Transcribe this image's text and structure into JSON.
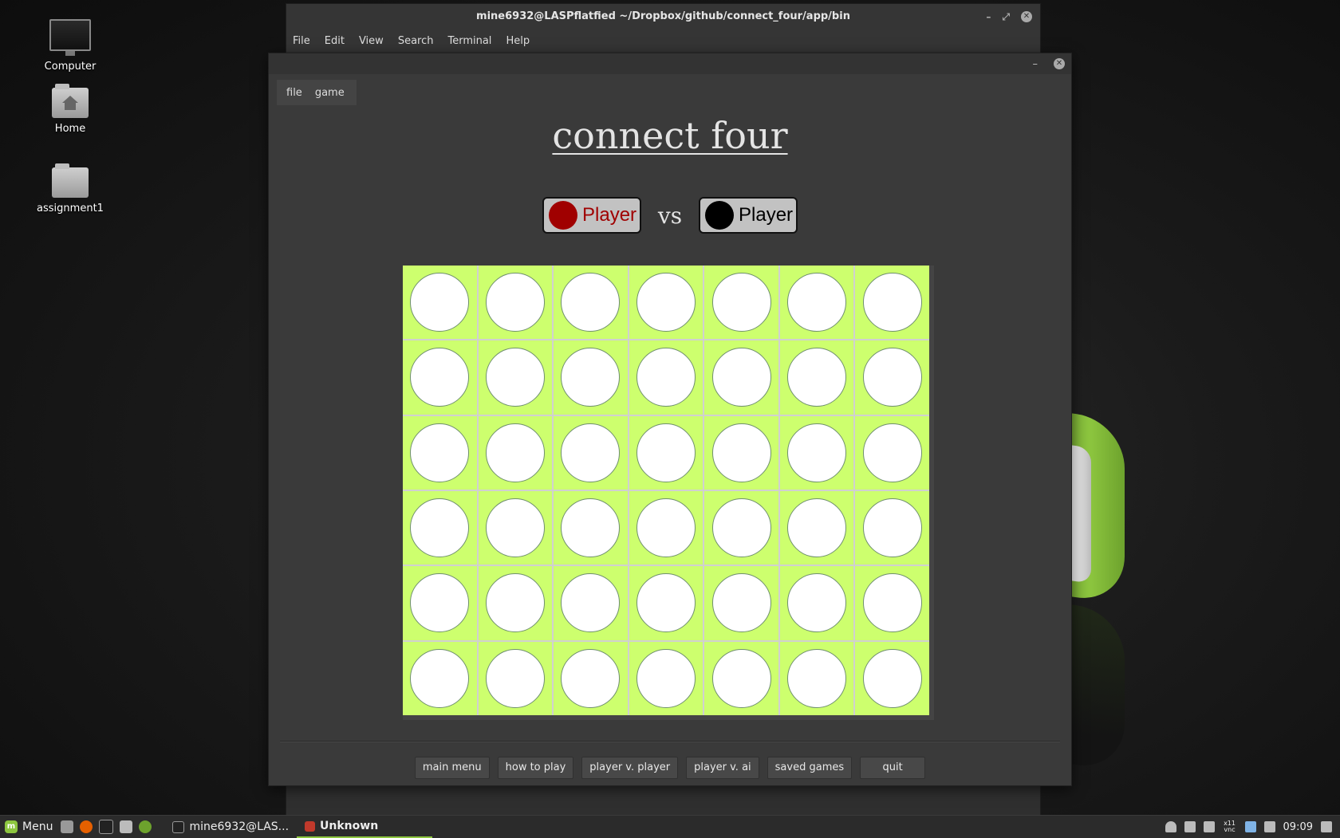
{
  "desktop": {
    "icons": [
      {
        "label": "Computer"
      },
      {
        "label": "Home"
      },
      {
        "label": "assignment1"
      }
    ]
  },
  "terminal": {
    "title": "mine6932@LASPflatfied ~/Dropbox/github/connect_four/app/bin",
    "menu": [
      "File",
      "Edit",
      "View",
      "Search",
      "Terminal",
      "Help"
    ]
  },
  "app": {
    "menu": [
      "file",
      "game"
    ],
    "title": "connect four",
    "player1": {
      "label": "Player",
      "color": "#a00000"
    },
    "vs": "vs",
    "player2": {
      "label": "Player",
      "color": "#000000"
    },
    "board": {
      "rows": 6,
      "cols": 7,
      "cell_color": "#cdff6e",
      "empty_color": "#ffffff"
    },
    "buttons": [
      "main menu",
      "how to play",
      "player v. player",
      "player v. ai",
      "saved games",
      "quit"
    ]
  },
  "taskbar": {
    "menu_label": "Menu",
    "tasks": [
      {
        "label": "mine6932@LAS..."
      },
      {
        "label": "Unknown"
      }
    ],
    "clock": "09:09",
    "vnc_label": "x11 vnc"
  }
}
